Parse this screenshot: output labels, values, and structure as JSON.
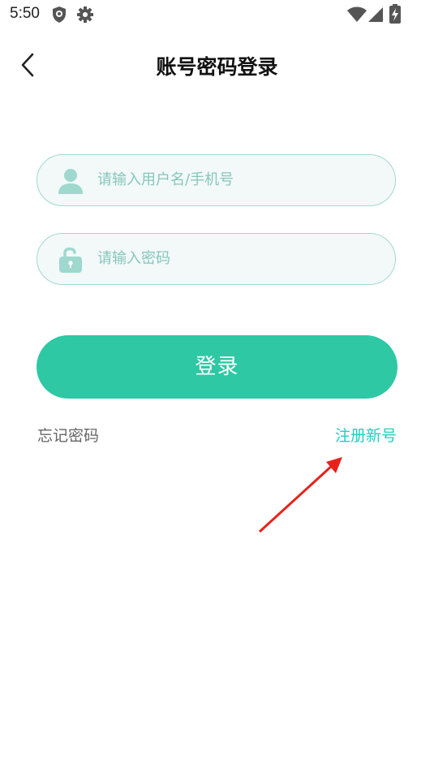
{
  "status_bar": {
    "time": "5:50",
    "left_icons": [
      "shield-icon",
      "gear-icon"
    ],
    "right_icons": [
      "wifi-icon",
      "signal-icon",
      "battery-charging-icon"
    ]
  },
  "header": {
    "title": "账号密码登录",
    "back_icon": "chevron-left-icon"
  },
  "form": {
    "username_placeholder": "请输入用户名/手机号",
    "username_value": "",
    "password_placeholder": "请输入密码",
    "password_value": "",
    "login_label": "登录",
    "forgot_label": "忘记密码",
    "register_label": "注册新号"
  },
  "colors": {
    "accent": "#2ec8a5",
    "link": "#1ecfc4",
    "input_border": "#a3d8cf",
    "input_bg": "#f2f9f8",
    "annotation_arrow": "#e8221b"
  }
}
